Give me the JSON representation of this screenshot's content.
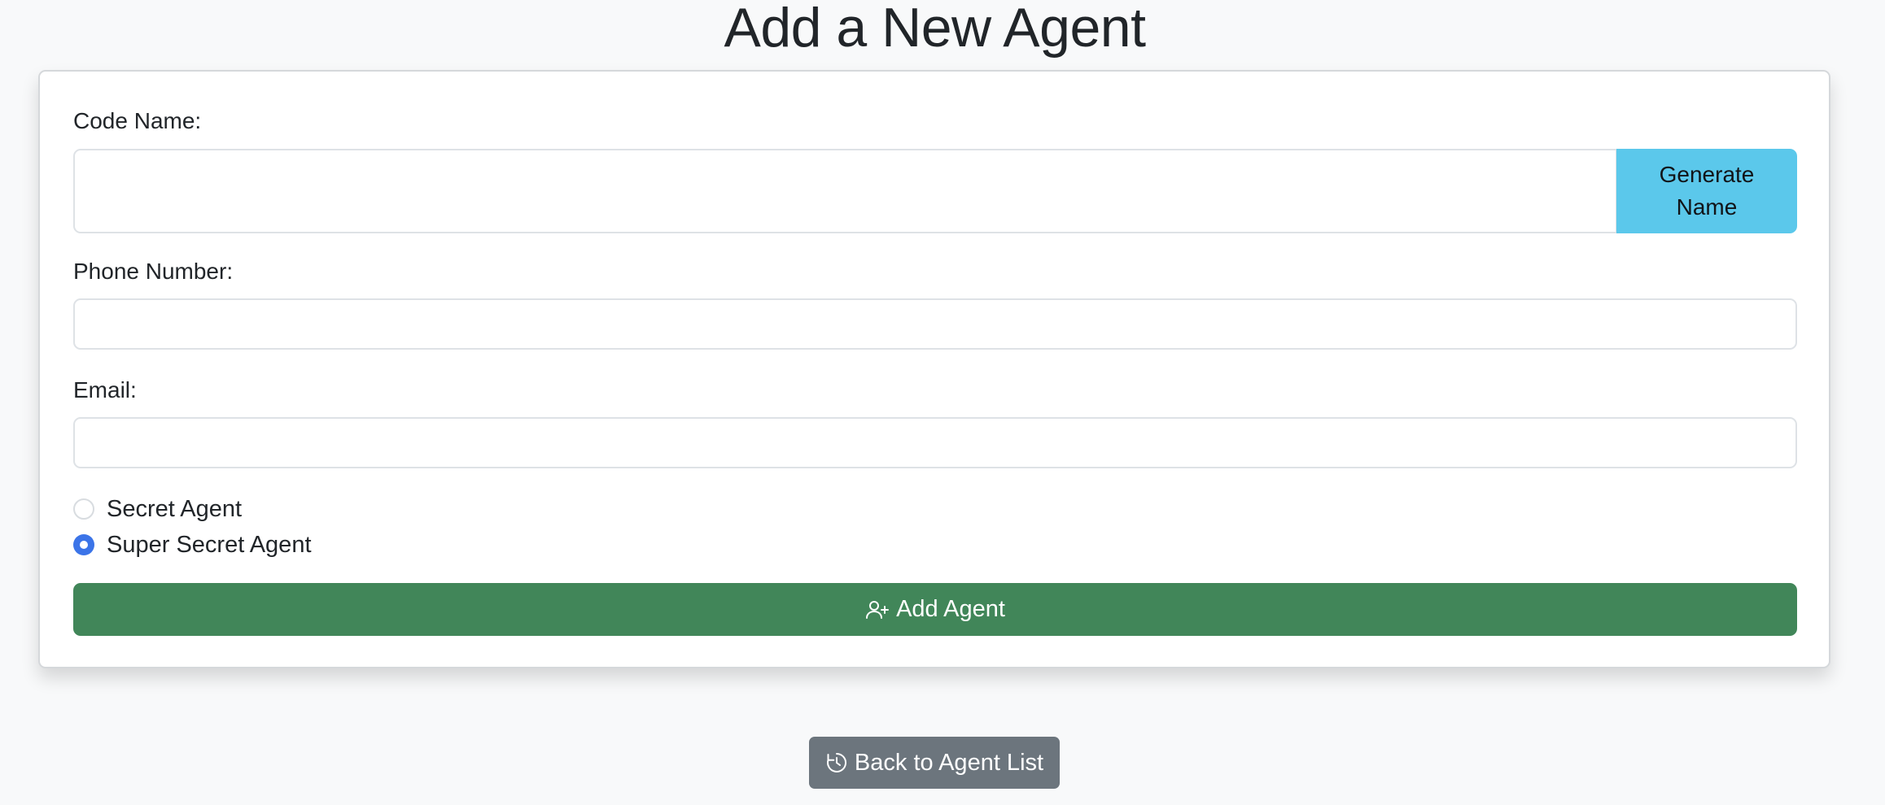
{
  "page": {
    "title": "Add a New Agent"
  },
  "form": {
    "code_name": {
      "label": "Code Name:",
      "value": "",
      "placeholder": ""
    },
    "generate_button_label": "Generate Name",
    "phone": {
      "label": "Phone Number:",
      "value": "",
      "placeholder": ""
    },
    "email": {
      "label": "Email:",
      "value": "",
      "placeholder": ""
    },
    "agent_type": {
      "options": [
        {
          "label": "Secret Agent",
          "checked": false
        },
        {
          "label": "Super Secret Agent",
          "checked": true
        }
      ]
    },
    "submit_button": {
      "label": "Add Agent",
      "icon": "person-plus-icon"
    }
  },
  "footer": {
    "back_button": {
      "label": "Back to Agent List",
      "icon": "clock-history-icon"
    }
  },
  "colors": {
    "background": "#f8f9fa",
    "generate_button": "#5bc8eb",
    "submit_button": "#418659",
    "back_button": "#6c757d",
    "radio_checked": "#3b74e8"
  }
}
